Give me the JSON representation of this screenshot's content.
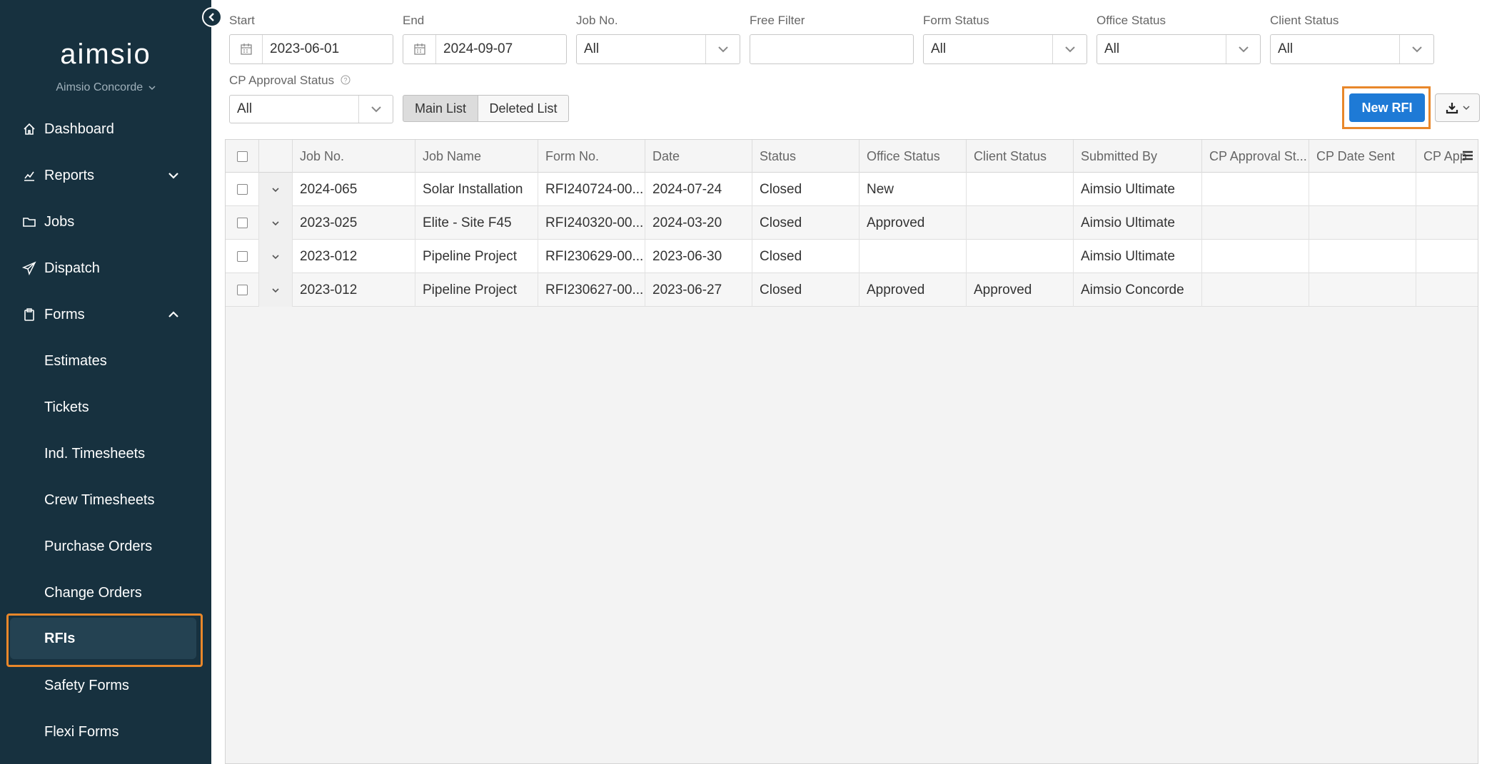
{
  "sidebar": {
    "logo": "aimsio",
    "company": "Aimsio Concorde",
    "nav": [
      {
        "label": "Dashboard",
        "icon": "home-icon"
      },
      {
        "label": "Reports",
        "icon": "chart-icon"
      },
      {
        "label": "Jobs",
        "icon": "folder-icon"
      },
      {
        "label": "Dispatch",
        "icon": "send-icon"
      },
      {
        "label": "Forms",
        "icon": "clipboard-icon"
      }
    ],
    "forms_sub": [
      {
        "label": "Estimates"
      },
      {
        "label": "Tickets"
      },
      {
        "label": "Ind. Timesheets"
      },
      {
        "label": "Crew Timesheets"
      },
      {
        "label": "Purchase Orders"
      },
      {
        "label": "Change Orders"
      },
      {
        "label": "RFIs",
        "active": true
      },
      {
        "label": "Safety Forms"
      },
      {
        "label": "Flexi Forms"
      }
    ]
  },
  "filters": {
    "start": {
      "label": "Start",
      "value": "2023-06-01"
    },
    "end": {
      "label": "End",
      "value": "2024-09-07"
    },
    "job_no": {
      "label": "Job No.",
      "value": "All"
    },
    "free_filter": {
      "label": "Free Filter",
      "value": ""
    },
    "form_status": {
      "label": "Form Status",
      "value": "All"
    },
    "office_status": {
      "label": "Office Status",
      "value": "All"
    },
    "client_status": {
      "label": "Client Status",
      "value": "All"
    },
    "cp_approval": {
      "label": "CP Approval Status",
      "value": "All"
    }
  },
  "toggle": {
    "main": "Main List",
    "deleted": "Deleted List"
  },
  "actions": {
    "new_rfi": "New RFI"
  },
  "grid": {
    "columns": [
      "Job No.",
      "Job Name",
      "Form No.",
      "Date",
      "Status",
      "Office Status",
      "Client Status",
      "Submitted By",
      "CP Approval St...",
      "CP Date Sent",
      "CP App"
    ],
    "rows": [
      [
        "2024-065",
        "Solar Installation",
        "RFI240724-00...",
        "2024-07-24",
        "Closed",
        "New",
        "",
        "Aimsio Ultimate",
        "",
        "",
        ""
      ],
      [
        "2023-025",
        "Elite - Site F45",
        "RFI240320-00...",
        "2024-03-20",
        "Closed",
        "Approved",
        "",
        "Aimsio Ultimate",
        "",
        "",
        ""
      ],
      [
        "2023-012",
        "Pipeline Project",
        "RFI230629-00...",
        "2023-06-30",
        "Closed",
        "",
        "",
        "Aimsio Ultimate",
        "",
        "",
        ""
      ],
      [
        "2023-012",
        "Pipeline Project",
        "RFI230627-00...",
        "2023-06-27",
        "Closed",
        "Approved",
        "Approved",
        "Aimsio Concorde",
        "",
        "",
        ""
      ]
    ]
  },
  "colors": {
    "sidebar": "#17313f",
    "accent": "#1e7ad6",
    "highlight": "#e8872a"
  }
}
